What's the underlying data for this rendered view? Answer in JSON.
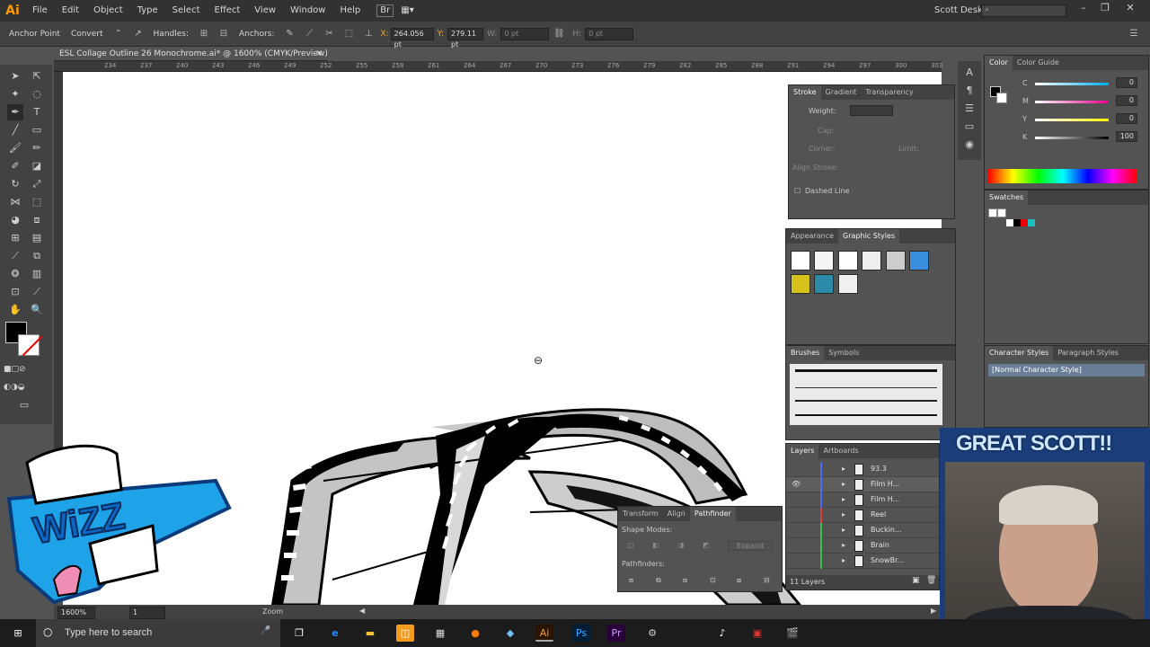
{
  "app": {
    "logo": "Ai",
    "menu": [
      "File",
      "Edit",
      "Object",
      "Type",
      "Select",
      "Effect",
      "View",
      "Window",
      "Help"
    ],
    "user": "Scott Desk"
  },
  "control_bar": {
    "anchor_point": "Anchor Point",
    "convert": "Convert",
    "handles": "Handles:",
    "anchors": "Anchors:",
    "x_label": "X:",
    "x_value": "264.056 pt",
    "y_label": "Y:",
    "y_value": "279.11 pt",
    "w_label": "W:",
    "w_value": "0 pt",
    "h_label": "H:",
    "h_value": "0 pt"
  },
  "document": {
    "tab_title": "ESL Collage Outline 26 Monochrome.ai* @ 1600% (CMYK/Preview)",
    "ruler_ticks": [
      "234",
      "237",
      "240",
      "243",
      "246",
      "249",
      "252",
      "255",
      "258",
      "261",
      "264",
      "267",
      "270",
      "273",
      "276",
      "279",
      "282",
      "285",
      "288",
      "291",
      "294",
      "297",
      "300",
      "303",
      "306"
    ]
  },
  "status_bar": {
    "zoom": "1600%",
    "artboard": "1",
    "tool": "Zoom"
  },
  "stroke_panel": {
    "tabs": [
      "Stroke",
      "Gradient",
      "Transparency"
    ],
    "weight_label": "Weight:",
    "cap_label": "Cap:",
    "corner_label": "Corner:",
    "limit_label": "Limit:",
    "align_label": "Align Stroke:",
    "dashed_label": "Dashed Line"
  },
  "appearance_panel": {
    "tabs": [
      "Appearance",
      "Graphic Styles"
    ]
  },
  "brushes_panel": {
    "tabs": [
      "Brushes",
      "Symbols"
    ]
  },
  "layers_panel": {
    "tabs": [
      "Layers",
      "Artboards"
    ],
    "layers": [
      {
        "name": "93.3",
        "color": "#4a6cf7"
      },
      {
        "name": "Film H...",
        "color": "#4a6cf7"
      },
      {
        "name": "Film H...",
        "color": "#4a6cf7"
      },
      {
        "name": "Reel",
        "color": "#e03c3c"
      },
      {
        "name": "Buckin...",
        "color": "#3cc04a"
      },
      {
        "name": "Brain",
        "color": "#3cc04a"
      },
      {
        "name": "SnowBr...",
        "color": "#3cc04a"
      }
    ],
    "count": "11 Layers"
  },
  "color_panel": {
    "tabs": [
      "Color",
      "Color Guide"
    ],
    "channels": [
      {
        "label": "C",
        "value": "0"
      },
      {
        "label": "M",
        "value": "0"
      },
      {
        "label": "Y",
        "value": "0"
      },
      {
        "label": "K",
        "value": "100"
      }
    ]
  },
  "swatches_panel": {
    "title": "Swatches"
  },
  "character_styles_panel": {
    "tabs": [
      "Character Styles",
      "Paragraph Styles"
    ],
    "selected_style": "[Normal Character Style]"
  },
  "pathfinder_panel": {
    "tabs": [
      "Transform",
      "Align",
      "Pathfinder"
    ],
    "shape_modes_label": "Shape Modes:",
    "pathfinders_label": "Pathfinders:",
    "expand_label": "Expand"
  },
  "taskbar": {
    "search_placeholder": "Type here to search"
  },
  "webcam": {
    "title": "GREAT SCOTT!!"
  },
  "colors": {
    "chrome_dark": "#323232",
    "panel": "#535353",
    "ai_orange": "#ff9a00"
  }
}
